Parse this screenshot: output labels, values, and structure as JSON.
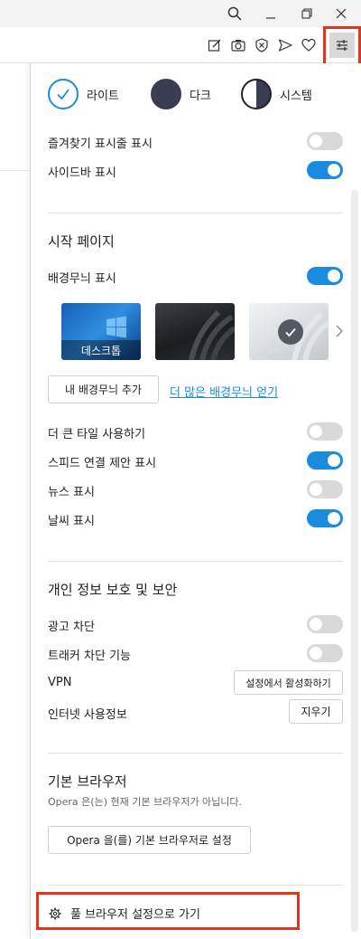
{
  "panel": {
    "themes": [
      {
        "label": "라이트"
      },
      {
        "label": "다크"
      },
      {
        "label": "시스템"
      }
    ],
    "general": {
      "bookmarks_bar": {
        "label": "즐겨찾기 표시줄 표시",
        "on": false
      },
      "sidebar": {
        "label": "사이드바 표시",
        "on": true
      }
    },
    "start_page": {
      "title": "시작 페이지",
      "wallpaper": {
        "label": "배경무늬 표시",
        "on": true
      },
      "wallpaper_thumbs": [
        {
          "label": "데스크톱",
          "selected": false
        },
        {
          "label": "",
          "selected": false
        },
        {
          "label": "",
          "selected": true
        }
      ],
      "add_wallpaper_button": "내 배경무늬 추가",
      "more_wallpapers_link": "더 많은 배경무늬 얻기",
      "larger_tiles": {
        "label": "더 큰 타일 사용하기",
        "on": false
      },
      "speed_dial_suggestions": {
        "label": "스피드 연결 제안 표시",
        "on": true
      },
      "news": {
        "label": "뉴스 표시",
        "on": false
      },
      "weather": {
        "label": "날씨 표시",
        "on": true
      }
    },
    "privacy": {
      "title": "개인 정보 보호 및 보안",
      "ad_block": {
        "label": "광고 차단",
        "on": false
      },
      "tracker_block": {
        "label": "트래커 차단 기능",
        "on": false
      },
      "vpn_label": "VPN",
      "vpn_button": "설정에서 활성화하기",
      "browsing_data_label": "인터넷 사용정보",
      "clear_button": "지우기"
    },
    "default_browser": {
      "title": "기본 브라우저",
      "status": "Opera 은(는) 현재 기본 브라우저가 아닙니다.",
      "set_default_button": "Opera 을(를) 기본 브라우저로 설정"
    },
    "full_settings_link": "풀 브라우저 설정으로 가기"
  },
  "colors": {
    "accent": "#1a8cdf",
    "highlight_box": "#e8321e",
    "toggle_off": "#d9d9d9",
    "dark_theme": "#3a3d52"
  }
}
